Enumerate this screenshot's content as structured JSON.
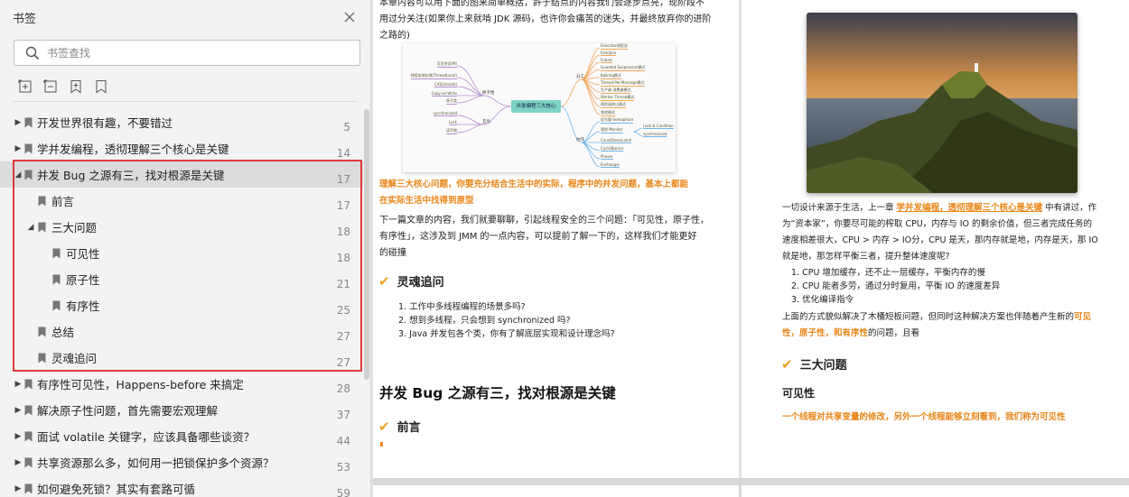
{
  "sidebar": {
    "title": "书签",
    "search_placeholder": "书签查找",
    "bookmarks": [
      {
        "label": "开发世界很有趣，不要错过",
        "page": "5",
        "level": 0,
        "caret": "▶"
      },
      {
        "label": "学并发编程，透彻理解三个核心是关键",
        "page": "14",
        "level": 0,
        "caret": "▶"
      },
      {
        "label": "并发 Bug 之源有三，找对根源是关键",
        "page": "17",
        "level": 0,
        "caret": "◢",
        "active": true
      },
      {
        "label": "前言",
        "page": "17",
        "level": 1
      },
      {
        "label": "三大问题",
        "page": "18",
        "level": 1,
        "caret": "◢"
      },
      {
        "label": "可见性",
        "page": "18",
        "level": 2
      },
      {
        "label": "原子性",
        "page": "21",
        "level": 2
      },
      {
        "label": "有序性",
        "page": "25",
        "level": 2
      },
      {
        "label": "总结",
        "page": "27",
        "level": 1
      },
      {
        "label": "灵魂追问",
        "page": "27",
        "level": 1
      },
      {
        "label": "有序性可见性，Happens-before 来搞定",
        "page": "28",
        "level": 0,
        "caret": "▶"
      },
      {
        "label": "解决原子性问题，首先需要宏观理解",
        "page": "37",
        "level": 0,
        "caret": "▶"
      },
      {
        "label": "面试 volatile 关键字，应该具备哪些谈资？",
        "page": "44",
        "level": 0,
        "caret": "▶"
      },
      {
        "label": "共享资源那么多，如何用一把锁保护多个资源？",
        "page": "53",
        "level": 0,
        "caret": "▶"
      },
      {
        "label": "如何避免死锁？其实有套路可循",
        "page": "59",
        "level": 0,
        "caret": "▶"
      }
    ]
  },
  "page1": {
    "intro": [
      "本章内容可以用下面的图来简单概括，許于结点的内容我们会逐步点亮，现阶段不",
      "用过分关注(如果你上来就啃 JDK 源码，也许你会痛苦的迷失，并最终放弃你的进阶",
      "之路的)"
    ],
    "highlight": [
      "理解三大核心问题，你要充分结合生活中的实际，程序中的并发问题，基本上都能",
      "在实际生活中找得到原型"
    ],
    "para": [
      "下一篇文章的内容，我们就要聊聊，引起线程安全的三个问题：「可见性，原子性，",
      "有序性」，这涉及到 JMM 的一点内容，可以提前了解一下的，这样我们才能更好",
      "的碰撞"
    ],
    "soul_heading": "灵魂追问",
    "soul_list": [
      "1.  工作中多线程编程的场景多吗?",
      "2.  想到多线程，只会想到 synchronized 吗?",
      "3.  Java 并发包各个类，你有了解底层实现和设计理念吗?"
    ],
    "chapter_title": "并发 Bug 之源有三，找对根源是关键",
    "preface_heading": "前言",
    "mindmap": {
      "center": "并发编程三大核心",
      "left_groups": [
        "分工",
        "原子性",
        "互斥"
      ],
      "right_groups": [
        "分工",
        "协作"
      ],
      "left_items": [
        "可见性(JVM)",
        "线程本地存储(ThreadLocal)",
        "CAS(Unsafe)",
        "Copy-on-Write",
        "原子类",
        "synchronized",
        "Lock",
        "读写锁"
      ],
      "right_items": [
        "Executor线程池",
        "Fork/Join",
        "Future",
        "Guarded Suspension模式",
        "Balking模式",
        "Thread-Per-Message模式",
        "生产者-消费者模式",
        "Worker Thread模式",
        "两阶段终止模式",
        "其他模式",
        "信号量-Semaphore",
        "管程-Monitor",
        "Lock & Condition",
        "synchronized",
        "CountDownLatch",
        "CyclicBarrier",
        "Phaser",
        "Exchanger"
      ]
    }
  },
  "page2": {
    "para1_pre": "一切设计来源于生活，上一章 ",
    "para1_link": "学并发编程，透彻理解三个核心是关键",
    "para1_post": " 中有讲过，作",
    "para1_rest": [
      "为“资本家”，你要尽可能的榨取 CPU，内存与 IO 的剩余价值，但三者完成任务的",
      "速度相差很大，CPU > 内存 > IO分，CPU 是天，那内存就是地，内存是天，那 IO",
      "就是地，那怎样平衡三者，提升整体速度呢?"
    ],
    "list": [
      "1.  CPU 增加缓存，还不止一层缓存，平衡内存的慢",
      "2.  CPU 能者多劳，通过分时复用，平衡 IO 的速度差异",
      "3.  优化编译指令"
    ],
    "para2_pre": "上面的方式貌似解决了木桶短板问题，但同时这种解决方案也伴随着产生新的",
    "para2_orange1": "可见",
    "para2_orange2": "性，原子性，和有序性",
    "para2_post": "的问题，且看",
    "three_heading": "三大问题",
    "visibility_heading": "可见性",
    "visibility_def": "一个线程对共享变量的修改，另外一个线程能够立刻看到，我们称为可见性"
  },
  "colors": {
    "accent_orange": "#e8861a",
    "highlight_red": "#e03a3a",
    "check": "#f0a020"
  }
}
